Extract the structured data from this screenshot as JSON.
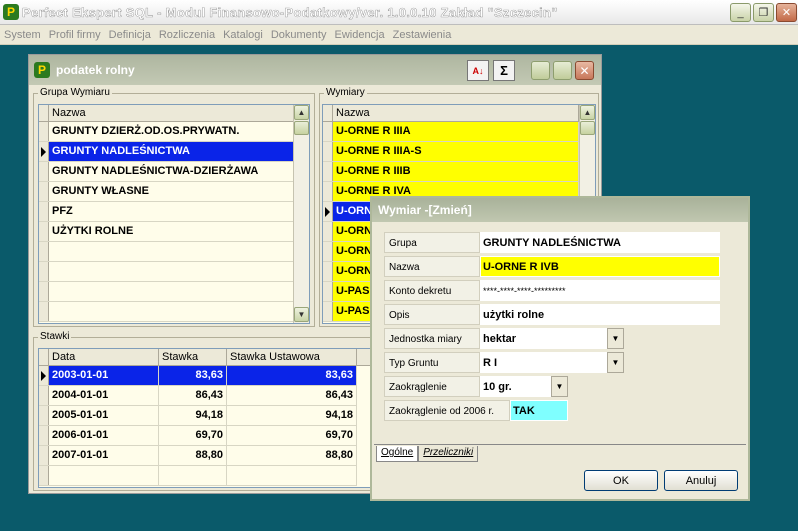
{
  "app": {
    "title": "Perfect Ekspert SQL - Modul Finansowo-Podatkowy/ver. 1.0.0.10 Zakład \"Szczecin\"",
    "menu": [
      "System",
      "Profil firmy",
      "Definicja",
      "Rozliczenia",
      "Katalogi",
      "Dokumenty",
      "Ewidencja",
      "Zestawienia"
    ]
  },
  "window": {
    "title": "podatek rolny",
    "sort_icon": "AZ",
    "sum_icon": "Σ"
  },
  "grupa": {
    "label": "Grupa Wymiaru",
    "header": "Nazwa",
    "rows": [
      "GRUNTY DZIERŻ.OD.OS.PRYWATN.",
      "GRUNTY NADLEŚNICTWA",
      "GRUNTY NADLEŚNICTWA-DZIERŻAWA",
      "GRUNTY WŁASNE",
      "PFZ",
      "UŻYTKI ROLNE"
    ]
  },
  "wymiary": {
    "label": "Wymiary",
    "header": "Nazwa",
    "rows": [
      "U-ORNE R IIIA",
      "U-ORNE R IIIA-S",
      "U-ORNE R IIIB",
      "U-ORNE R IVA",
      "U-ORNE R IVB",
      "U-ORNE R IVB",
      "U-ORNE R V",
      "U-ORNE R VI",
      "U-PAS",
      "U-PAS"
    ],
    "row_texts": [
      "U-ORNE R IIIA",
      "U-ORNE R IIIA-S",
      "U-ORNE R IIIB",
      "U-ORNE R IVA",
      "U-ORN",
      "U-ORN",
      "U-ORN",
      "U-ORN",
      "U-PAS",
      "U-PAS"
    ]
  },
  "stawki": {
    "label": "Stawki",
    "headers": [
      "Data",
      "Stawka",
      "Stawka Ustawowa"
    ],
    "rows": [
      {
        "data": "2003-01-01",
        "stawka": "83,63",
        "ustawowa": "83,63"
      },
      {
        "data": "2004-01-01",
        "stawka": "86,43",
        "ustawowa": "86,43"
      },
      {
        "data": "2005-01-01",
        "stawka": "94,18",
        "ustawowa": "94,18"
      },
      {
        "data": "2006-01-01",
        "stawka": "69,70",
        "ustawowa": "69,70"
      },
      {
        "data": "2007-01-01",
        "stawka": "88,80",
        "ustawowa": "88,80"
      }
    ]
  },
  "dialog": {
    "title": "Wymiar -[Zmień]",
    "fields": {
      "grupa_label": "Grupa",
      "grupa": "GRUNTY NADLEŚNICTWA",
      "nazwa_label": "Nazwa",
      "nazwa": "U-ORNE R IVB",
      "konto_label": "Konto dekretu",
      "konto": "****-****-****-*********",
      "opis_label": "Opis",
      "opis": "użytki rolne",
      "jm_label": "Jednostka miary",
      "jm": "hektar",
      "typ_label": "Typ Gruntu",
      "typ": "R I",
      "zaokr_label": "Zaokrąglenie",
      "zaokr": "10 gr.",
      "zaokr2006_label": "Zaokrąglenie od 2006 r.",
      "zaokr2006": "TAK"
    },
    "tabs": [
      "Ogólne",
      "Przeliczniki"
    ],
    "ok": "OK",
    "cancel": "Anuluj"
  }
}
